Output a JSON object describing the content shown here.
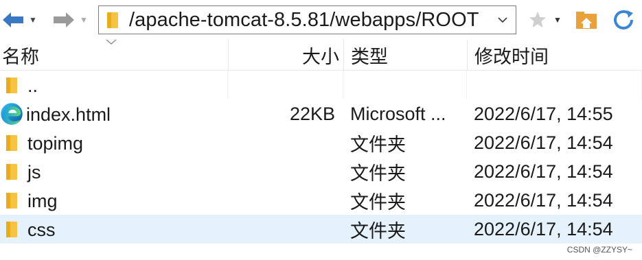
{
  "toolbar": {
    "address_path": "/apache-tomcat-8.5.81/webapps/ROOT"
  },
  "columns": {
    "name": "名称",
    "size": "大小",
    "type": "类型",
    "modified": "修改时间"
  },
  "rows": [
    {
      "name": "..",
      "size": "",
      "type": "",
      "modified": "",
      "icon": "folder-icon"
    },
    {
      "name": "index.html",
      "size": "22KB",
      "type": "Microsoft ...",
      "modified": "2022/6/17, 14:55",
      "icon": "edge-html-file-icon"
    },
    {
      "name": "topimg",
      "size": "",
      "type": "文件夹",
      "modified": "2022/6/17, 14:54",
      "icon": "folder-icon"
    },
    {
      "name": "js",
      "size": "",
      "type": "文件夹",
      "modified": "2022/6/17, 14:54",
      "icon": "folder-icon"
    },
    {
      "name": "img",
      "size": "",
      "type": "文件夹",
      "modified": "2022/6/17, 14:54",
      "icon": "folder-icon"
    },
    {
      "name": "css",
      "size": "",
      "type": "文件夹",
      "modified": "2022/6/17, 14:54",
      "icon": "folder-icon",
      "selected": true
    }
  ],
  "watermark": "CSDN @ZZYSY~",
  "colors": {
    "selection": "#e5f1fb",
    "folder": "#f5c242",
    "nav_arrow": "#3b78c4",
    "refresh": "#3a86d4"
  }
}
